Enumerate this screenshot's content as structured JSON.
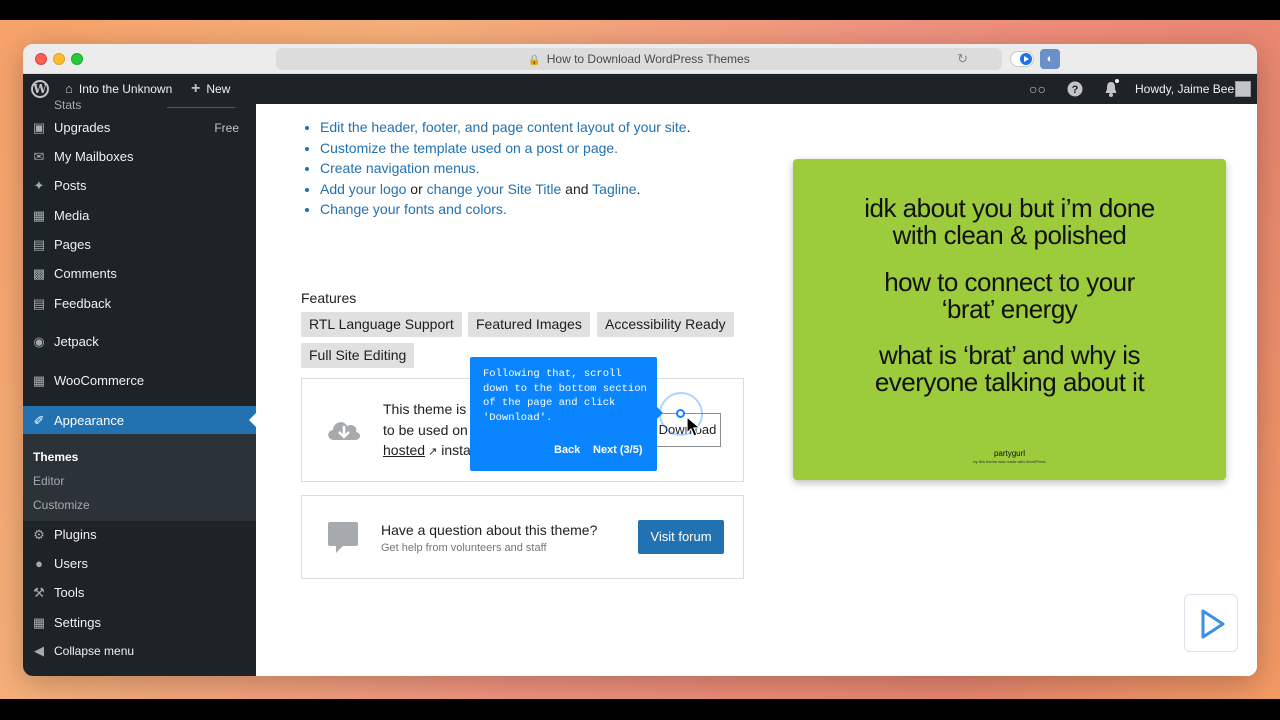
{
  "browser": {
    "tab_title": "How to Download WordPress Themes",
    "ext_label": "◐"
  },
  "adminbar": {
    "site_name": "Into the Unknown",
    "new_label": "New",
    "howdy": "Howdy, Jaime Bee"
  },
  "sidebar": {
    "partial_label": "Stats",
    "items": [
      {
        "label": "Upgrades",
        "badge": "Free",
        "icon": "upgrades-icon"
      },
      {
        "label": "My Mailboxes",
        "icon": "mail-icon"
      },
      {
        "label": "Posts",
        "icon": "pin-icon"
      },
      {
        "label": "Media",
        "icon": "media-icon"
      },
      {
        "label": "Pages",
        "icon": "pages-icon"
      },
      {
        "label": "Comments",
        "icon": "comments-icon"
      },
      {
        "label": "Feedback",
        "icon": "feedback-icon"
      },
      {
        "label": "Jetpack",
        "icon": "jetpack-icon"
      },
      {
        "label": "WooCommerce",
        "icon": "woo-icon"
      },
      {
        "label": "Appearance",
        "icon": "brush-icon"
      },
      {
        "label": "Plugins",
        "icon": "plugin-icon"
      },
      {
        "label": "Users",
        "icon": "users-icon"
      },
      {
        "label": "Tools",
        "icon": "wrench-icon"
      },
      {
        "label": "Settings",
        "icon": "settings-icon"
      },
      {
        "label": "Collapse menu",
        "icon": "collapse-icon"
      }
    ],
    "submenu": [
      "Themes",
      "Editor",
      "Customize"
    ]
  },
  "content": {
    "bullets": {
      "b1_link": "Edit the header, footer, and page content layout of your site",
      "b1_tail": ".",
      "b2_link": "Customize the template used on a post or page.",
      "b3_link": "Create navigation menus.",
      "b4_link1": "Add your logo",
      "b4_mid1": " or ",
      "b4_link2": "change your Site Title",
      "b4_mid2": " and ",
      "b4_link3": "Tagline",
      "b4_tail": ".",
      "b5_link": "Change your fonts and colors."
    },
    "features_title": "Features",
    "features": [
      "RTL Language Support",
      "Featured Images",
      "Accessibility Ready",
      "Full Site Editing"
    ],
    "download_box": {
      "line1": "This theme is a",
      "line2": "to be used on",
      "line3_link": "hosted",
      "line3_tail": " insta",
      "button": "Download"
    },
    "question_box": {
      "title": "Have a question about this theme?",
      "subtitle": "Get help from volunteers and staff",
      "button": "Visit forum"
    }
  },
  "preview": {
    "lines": [
      "idk about you but i’m done",
      "with clean & polished",
      "how to connect to your",
      "‘brat’ energy",
      "what is ‘brat’ and why is",
      "everyone talking about it"
    ],
    "brand": "partygurl",
    "tiny": "by this theme was made with WordPress"
  },
  "tooltip": {
    "message": "Following that, scroll down to the bottom section of the page and click 'Download'.",
    "back": "Back",
    "next": "Next (3/5)"
  },
  "colors": {
    "wp_dark": "#1d2327",
    "wp_blue": "#2271b1",
    "tooltip_blue": "#0a84ff",
    "preview_green": "#9ccb3b"
  }
}
